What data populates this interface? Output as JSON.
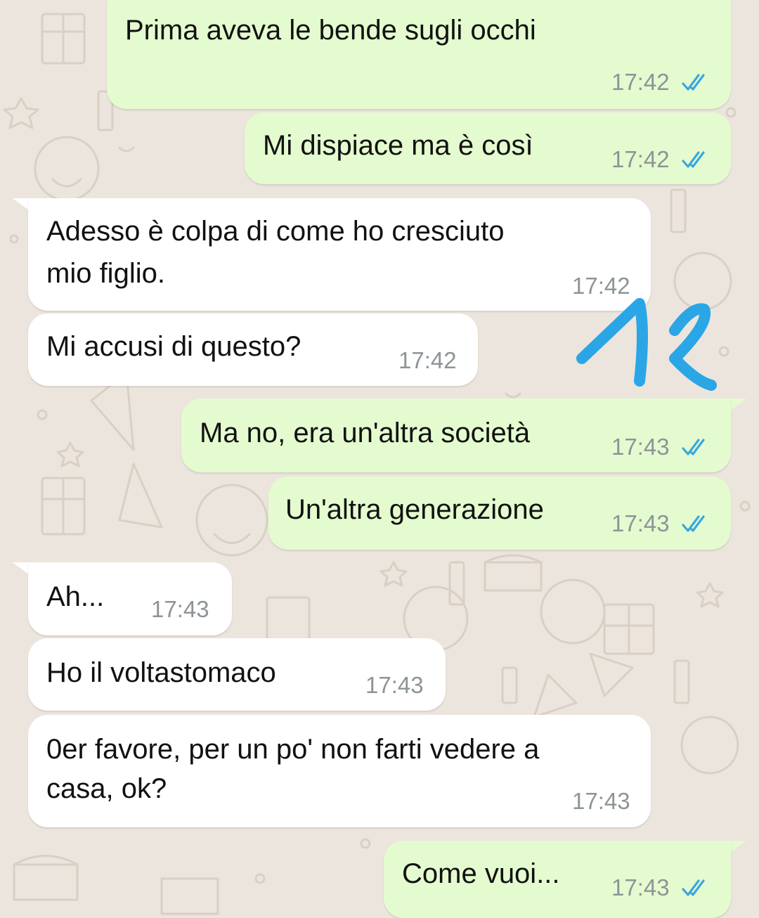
{
  "chat": {
    "messages": [
      {
        "direction": "outgoing",
        "text": "Prima aveva le bende sugli occhi",
        "time": "17:42",
        "status": "read"
      },
      {
        "direction": "outgoing",
        "text": "Mi dispiace ma è così",
        "time": "17:42",
        "status": "read"
      },
      {
        "direction": "incoming",
        "line1": "Adesso è colpa di come ho cresciuto",
        "line2": "mio figlio.",
        "time": "17:42"
      },
      {
        "direction": "incoming",
        "text": "Mi accusi di questo?",
        "time": "17:42"
      },
      {
        "direction": "outgoing",
        "text": "Ma no, era un'altra società",
        "time": "17:43",
        "status": "read"
      },
      {
        "direction": "outgoing",
        "text": "Un'altra generazione",
        "time": "17:43",
        "status": "read"
      },
      {
        "direction": "incoming",
        "text": "Ah...",
        "time": "17:43"
      },
      {
        "direction": "incoming",
        "text": "Ho il voltastomaco",
        "time": "17:43"
      },
      {
        "direction": "incoming",
        "line1": "0er favore, per un po' non farti vedere a",
        "line2": "casa, ok?",
        "time": "17:43"
      },
      {
        "direction": "outgoing",
        "text": "Come vuoi...",
        "time": "17:43",
        "status": "read"
      }
    ]
  },
  "annotation": {
    "text": "12",
    "color": "#2aa6e6"
  },
  "colors": {
    "background": "#ece5dd",
    "outgoing_bubble": "#e4fbcf",
    "incoming_bubble": "#ffffff",
    "timestamp": "#8d9497",
    "read_ticks": "#3aa7e0"
  }
}
